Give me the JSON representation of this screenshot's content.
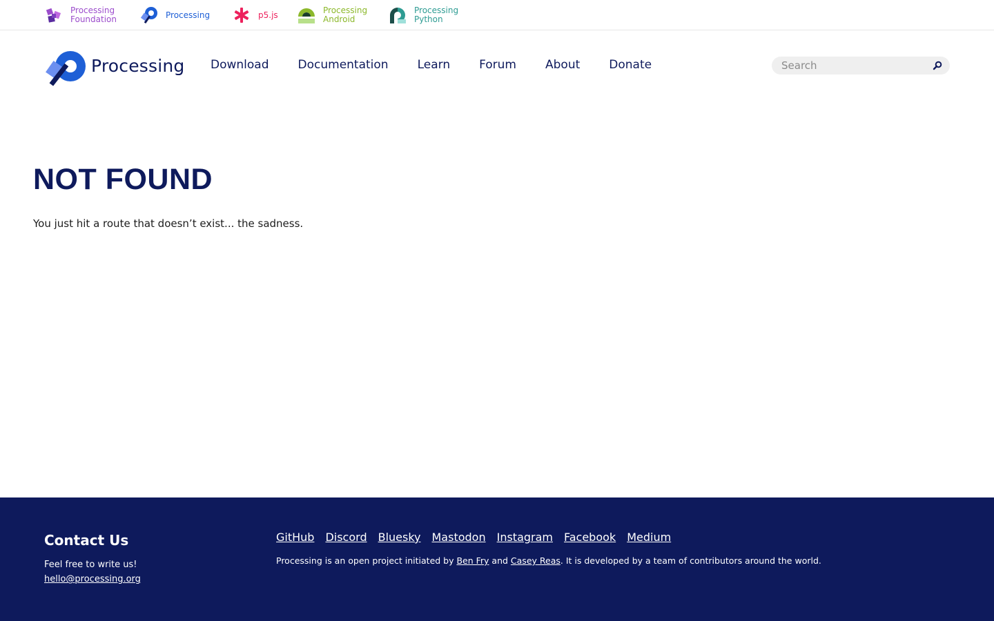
{
  "topbar": {
    "sites": [
      {
        "label": "Processing\nFoundation",
        "color": "#9c4dcc",
        "icon": "processing-foundation-icon"
      },
      {
        "label": "Processing",
        "color": "#1e5fd6",
        "icon": "processing-icon"
      },
      {
        "label": "p5.js",
        "color": "#ed225d",
        "icon": "p5js-icon"
      },
      {
        "label": "Processing\nAndroid",
        "color": "#8cb82b",
        "icon": "android-icon"
      },
      {
        "label": "Processing\nPython",
        "color": "#2e9c93",
        "icon": "python-icon"
      }
    ]
  },
  "header": {
    "brand": "Processing",
    "nav": [
      "Download",
      "Documentation",
      "Learn",
      "Forum",
      "About",
      "Donate"
    ],
    "search_placeholder": "Search"
  },
  "main": {
    "title": "NOT FOUND",
    "message": "You just hit a route that doesn’t exist... the sadness."
  },
  "footer": {
    "contact_title": "Contact Us",
    "contact_text": "Feel free to write us!",
    "contact_email": "hello@processing.org",
    "social": [
      "GitHub",
      "Discord",
      "Bluesky",
      "Mastodon",
      "Instagram",
      "Facebook",
      "Medium"
    ],
    "credits_prefix": "Processing is an open project initiated by ",
    "credits_author1": "Ben Fry",
    "credits_and": " and ",
    "credits_author2": "Casey Reas",
    "credits_suffix": ". It is developed by a team of contributors around the world."
  },
  "colors": {
    "navy": "#0e1a5c",
    "accent_blue": "#1e5fd6"
  }
}
